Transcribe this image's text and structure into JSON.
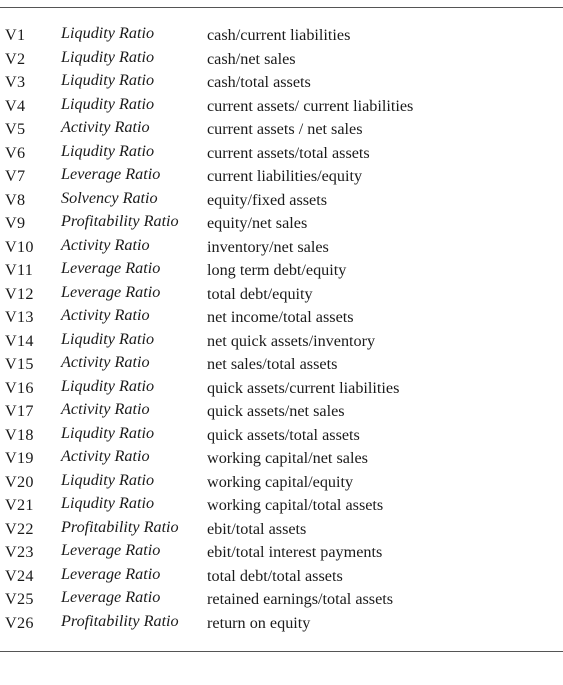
{
  "table": {
    "rows": [
      {
        "id": "V1",
        "category": "Liqudity Ratio",
        "description": "cash/current liabilities"
      },
      {
        "id": "V2",
        "category": "Liqudity Ratio",
        "description": "cash/net sales"
      },
      {
        "id": "V3",
        "category": "Liqudity Ratio",
        "description": "cash/total assets"
      },
      {
        "id": "V4",
        "category": "Liqudity Ratio",
        "description": "current assets/ current liabilities"
      },
      {
        "id": "V5",
        "category": "Activity Ratio",
        "description": "current assets / net sales"
      },
      {
        "id": "V6",
        "category": "Liqudity Ratio",
        "description": "current assets/total assets"
      },
      {
        "id": "V7",
        "category": "Leverage Ratio",
        "description": "current liabilities/equity"
      },
      {
        "id": "V8",
        "category": "Solvency Ratio",
        "description": "equity/fixed assets"
      },
      {
        "id": "V9",
        "category": "Profitability Ratio",
        "description": "equity/net sales"
      },
      {
        "id": "V10",
        "category": "Activity Ratio",
        "description": "inventory/net sales"
      },
      {
        "id": "V11",
        "category": "Leverage Ratio",
        "description": "long term debt/equity"
      },
      {
        "id": "V12",
        "category": "Leverage Ratio",
        "description": "total debt/equity"
      },
      {
        "id": "V13",
        "category": "Activity Ratio",
        "description": "net income/total assets"
      },
      {
        "id": "V14",
        "category": "Liqudity Ratio",
        "description": "net quick assets/inventory"
      },
      {
        "id": "V15",
        "category": "Activity Ratio",
        "description": "net sales/total assets"
      },
      {
        "id": "V16",
        "category": "Liqudity Ratio",
        "description": "quick assets/current liabilities"
      },
      {
        "id": "V17",
        "category": "Activity Ratio",
        "description": "quick assets/net sales"
      },
      {
        "id": "V18",
        "category": "Liqudity Ratio",
        "description": "quick assets/total assets"
      },
      {
        "id": "V19",
        "category": "Activity Ratio",
        "description": "working capital/net sales"
      },
      {
        "id": "V20",
        "category": "Liqudity Ratio",
        "description": "working capital/equity"
      },
      {
        "id": "V21",
        "category": "Liqudity Ratio",
        "description": "working capital/total assets"
      },
      {
        "id": "V22",
        "category": "Profitability Ratio",
        "description": "ebit/total assets"
      },
      {
        "id": "V23",
        "category": "Leverage Ratio",
        "description": "ebit/total interest payments"
      },
      {
        "id": "V24",
        "category": "Leverage Ratio",
        "description": "total debt/total assets"
      },
      {
        "id": "V25",
        "category": "Leverage Ratio",
        "description": "retained earnings/total assets"
      },
      {
        "id": "V26",
        "category": "Profitability Ratio",
        "description": "return on equity"
      }
    ]
  }
}
